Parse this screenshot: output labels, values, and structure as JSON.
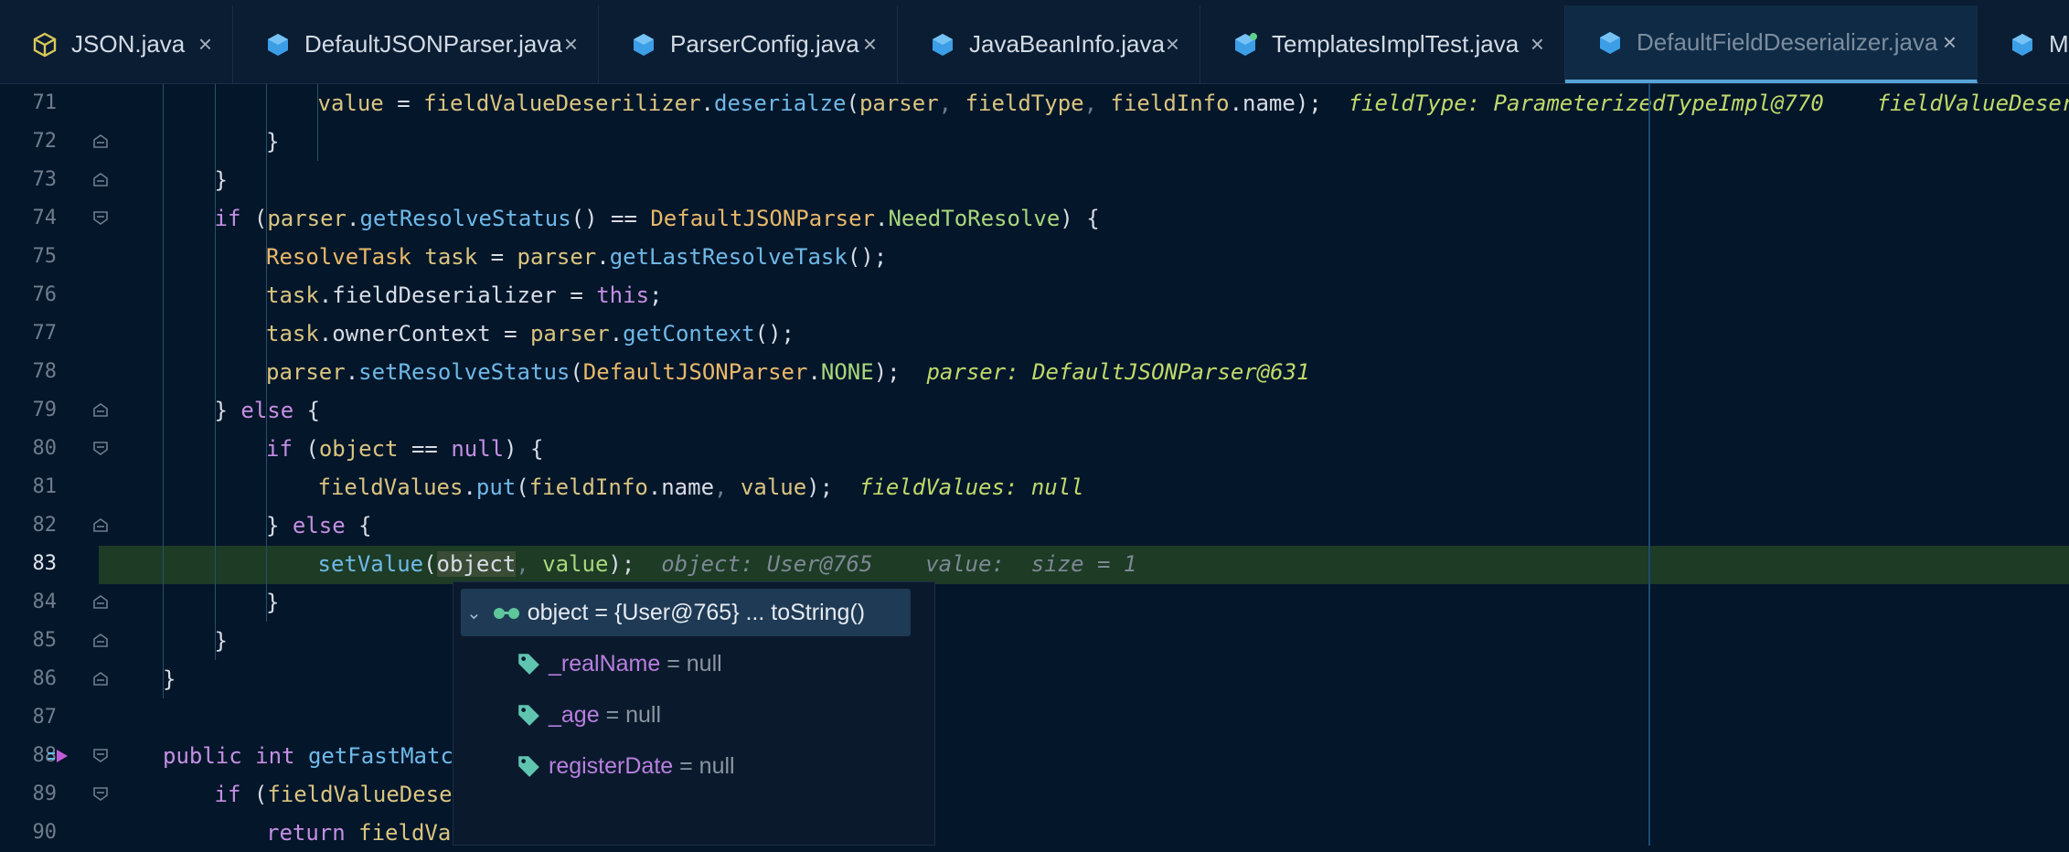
{
  "tabs": [
    {
      "label": "JSON.java",
      "icon": "java-module-icon",
      "active": false
    },
    {
      "label": "DefaultJSONParser.java",
      "icon": "java-class-icon",
      "active": false
    },
    {
      "label": "ParserConfig.java",
      "icon": "java-class-icon",
      "active": false
    },
    {
      "label": "JavaBeanInfo.java",
      "icon": "java-class-icon",
      "active": false
    },
    {
      "label": "TemplatesImplTest.java",
      "icon": "java-test-class-icon",
      "active": false
    },
    {
      "label": "DefaultFieldDeserializer.java",
      "icon": "java-class-icon",
      "active": true
    },
    {
      "label": "Ma",
      "icon": "java-class-icon",
      "active": false
    }
  ],
  "tab_close_glyph": "×",
  "lines": [
    {
      "n": "71",
      "indent": 3,
      "segments": [
        [
          "value ",
          "v"
        ],
        [
          "= ",
          ""
        ],
        [
          "fieldValueDeserilizer",
          "v"
        ],
        [
          ".",
          ""
        ],
        [
          "deserialze",
          "f"
        ],
        [
          "(",
          ""
        ],
        [
          "parser",
          "v"
        ],
        [
          ", ",
          "cm"
        ],
        [
          "fieldType",
          "v"
        ],
        [
          ", ",
          "cm"
        ],
        [
          "fieldInfo",
          "v"
        ],
        [
          ".name",
          ""
        ],
        [
          ");  ",
          ""
        ]
      ],
      "hints": [
        [
          "fieldType: ParameterizedTypeImpl@770",
          "hint"
        ],
        [
          "    fieldValueDeserilizer",
          "hint"
        ]
      ]
    },
    {
      "n": "72",
      "indent": 2,
      "segments": [
        [
          "}",
          ""
        ]
      ],
      "hints": []
    },
    {
      "n": "73",
      "indent": 1,
      "segments": [
        [
          "}",
          ""
        ]
      ],
      "hints": []
    },
    {
      "n": "74",
      "indent": 1,
      "segments": [
        [
          "if ",
          "k"
        ],
        [
          "(",
          ""
        ],
        [
          "parser",
          "v"
        ],
        [
          ".",
          ""
        ],
        [
          "getResolveStatus",
          "f"
        ],
        [
          "() == ",
          ""
        ],
        [
          "DefaultJSONParser",
          "t"
        ],
        [
          ".",
          ""
        ],
        [
          "NeedToResolve",
          "n"
        ],
        [
          ") {",
          ""
        ]
      ],
      "hints": []
    },
    {
      "n": "75",
      "indent": 2,
      "segments": [
        [
          "ResolveTask ",
          "t"
        ],
        [
          "task ",
          "v"
        ],
        [
          "= ",
          ""
        ],
        [
          "parser",
          "v"
        ],
        [
          ".",
          ""
        ],
        [
          "getLastResolveTask",
          "f"
        ],
        [
          "();",
          ""
        ]
      ],
      "hints": []
    },
    {
      "n": "76",
      "indent": 2,
      "segments": [
        [
          "task",
          "v"
        ],
        [
          ".fieldDeserializer = ",
          ""
        ],
        [
          "this",
          "k"
        ],
        [
          ";",
          ""
        ]
      ],
      "hints": []
    },
    {
      "n": "77",
      "indent": 2,
      "segments": [
        [
          "task",
          "v"
        ],
        [
          ".ownerContext = ",
          ""
        ],
        [
          "parser",
          "v"
        ],
        [
          ".",
          ""
        ],
        [
          "getContext",
          "f"
        ],
        [
          "();",
          ""
        ]
      ],
      "hints": []
    },
    {
      "n": "78",
      "indent": 2,
      "segments": [
        [
          "parser",
          "v"
        ],
        [
          ".",
          ""
        ],
        [
          "setResolveStatus",
          "f"
        ],
        [
          "(",
          ""
        ],
        [
          "DefaultJSONParser",
          "t"
        ],
        [
          ".",
          ""
        ],
        [
          "NONE",
          "n"
        ],
        [
          ");  ",
          ""
        ]
      ],
      "hints": [
        [
          "parser: DefaultJSONParser@631",
          "hint"
        ]
      ]
    },
    {
      "n": "79",
      "indent": 1,
      "segments": [
        [
          "} ",
          ""
        ],
        [
          "else ",
          "k"
        ],
        [
          "{",
          ""
        ]
      ],
      "hints": []
    },
    {
      "n": "80",
      "indent": 2,
      "segments": [
        [
          "if ",
          "k"
        ],
        [
          "(",
          ""
        ],
        [
          "object ",
          "v"
        ],
        [
          "== ",
          ""
        ],
        [
          "null",
          "k"
        ],
        [
          ") {",
          ""
        ]
      ],
      "hints": []
    },
    {
      "n": "81",
      "indent": 3,
      "segments": [
        [
          "fieldValues",
          "v"
        ],
        [
          ".",
          ""
        ],
        [
          "put",
          "f"
        ],
        [
          "(",
          ""
        ],
        [
          "fieldInfo",
          "v"
        ],
        [
          ".name",
          ""
        ],
        [
          ", ",
          "cm"
        ],
        [
          "value",
          "v"
        ],
        [
          ");  ",
          ""
        ]
      ],
      "hints": [
        [
          "fieldValues: null",
          "hint"
        ]
      ]
    },
    {
      "n": "82",
      "indent": 2,
      "segments": [
        [
          "} ",
          ""
        ],
        [
          "else ",
          "k"
        ],
        [
          "{",
          ""
        ]
      ],
      "hints": []
    },
    {
      "n": "83",
      "indent": 3,
      "segments": [
        [
          "setValue",
          "f"
        ],
        [
          "(",
          ""
        ],
        [
          "object",
          "sel"
        ],
        [
          ", ",
          "cm"
        ],
        [
          "value",
          "n"
        ],
        [
          ");  ",
          ""
        ]
      ],
      "hints": [
        [
          "object: User@765    value:  size = 1",
          "hint grey"
        ]
      ]
    },
    {
      "n": "84",
      "indent": 2,
      "segments": [
        [
          "}",
          ""
        ]
      ],
      "hints": []
    },
    {
      "n": "85",
      "indent": 1,
      "segments": [
        [
          "}",
          ""
        ]
      ],
      "hints": []
    },
    {
      "n": "86",
      "indent": 0,
      "segments": [
        [
          "}",
          ""
        ]
      ],
      "hints": []
    },
    {
      "n": "87",
      "indent": 0,
      "segments": [],
      "hints": []
    },
    {
      "n": "88",
      "indent": 0,
      "segments": [
        [
          "public ",
          "k"
        ],
        [
          "int ",
          "k"
        ],
        [
          "getFastMatc",
          "f"
        ]
      ],
      "hints": []
    },
    {
      "n": "89",
      "indent": 1,
      "segments": [
        [
          "if ",
          "k"
        ],
        [
          "(",
          ""
        ],
        [
          "fieldValueDese",
          "v"
        ]
      ],
      "hints": []
    },
    {
      "n": "90",
      "indent": 2,
      "segments": [
        [
          "return ",
          "k"
        ],
        [
          "fieldVa",
          "v"
        ]
      ],
      "hints": []
    }
  ],
  "popup": {
    "header": "object = {User@765} ... toString()",
    "fields": [
      {
        "name": "_realName",
        "value": " = null"
      },
      {
        "name": "_age",
        "value": " = null"
      },
      {
        "name": "registerDate",
        "value": " = null"
      }
    ]
  },
  "colors": {
    "background": "#04162a",
    "current_line": "#1b3a22",
    "accent": "#58a4d8"
  }
}
